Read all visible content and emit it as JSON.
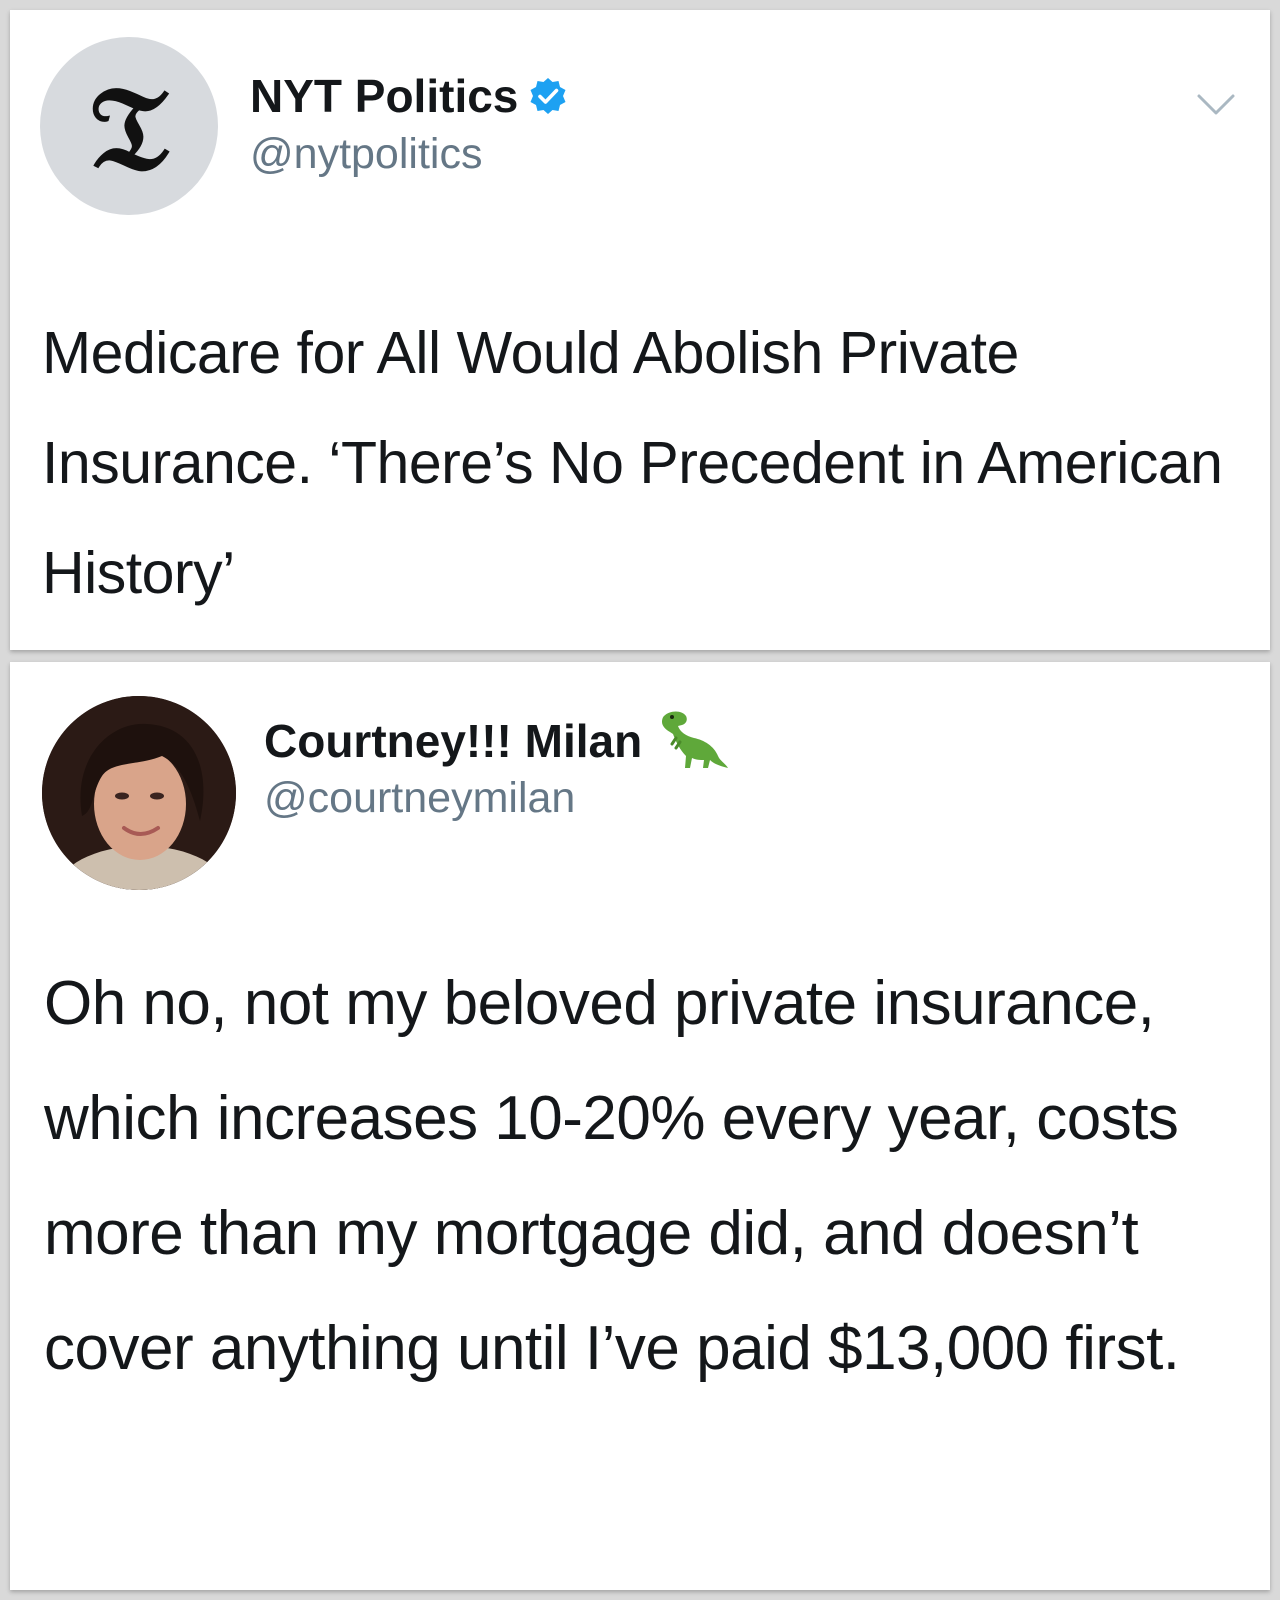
{
  "tweets": [
    {
      "name": "NYT Politics",
      "handle": "@nytpolitics",
      "avatar_icon": "nyt-logo-icon",
      "avatar_glyph": "𝔗",
      "verified": true,
      "text": "Medicare for All Would Abolish Private Insurance. ‘There’s No Precedent in American History’"
    },
    {
      "name": "Courtney!!! Milan",
      "handle": "@courtneymilan",
      "name_emoji_icon": "t-rex-emoji-icon",
      "text": "Oh no, not my beloved private insurance, which increases 10-20% every year, costs more than my mortgage did, and doesn’t cover anything until I’ve paid $13,000 first."
    }
  ],
  "colors": {
    "verified_blue": "#1da1f2",
    "handle_gray": "#657786",
    "text_dark": "#14171a"
  }
}
